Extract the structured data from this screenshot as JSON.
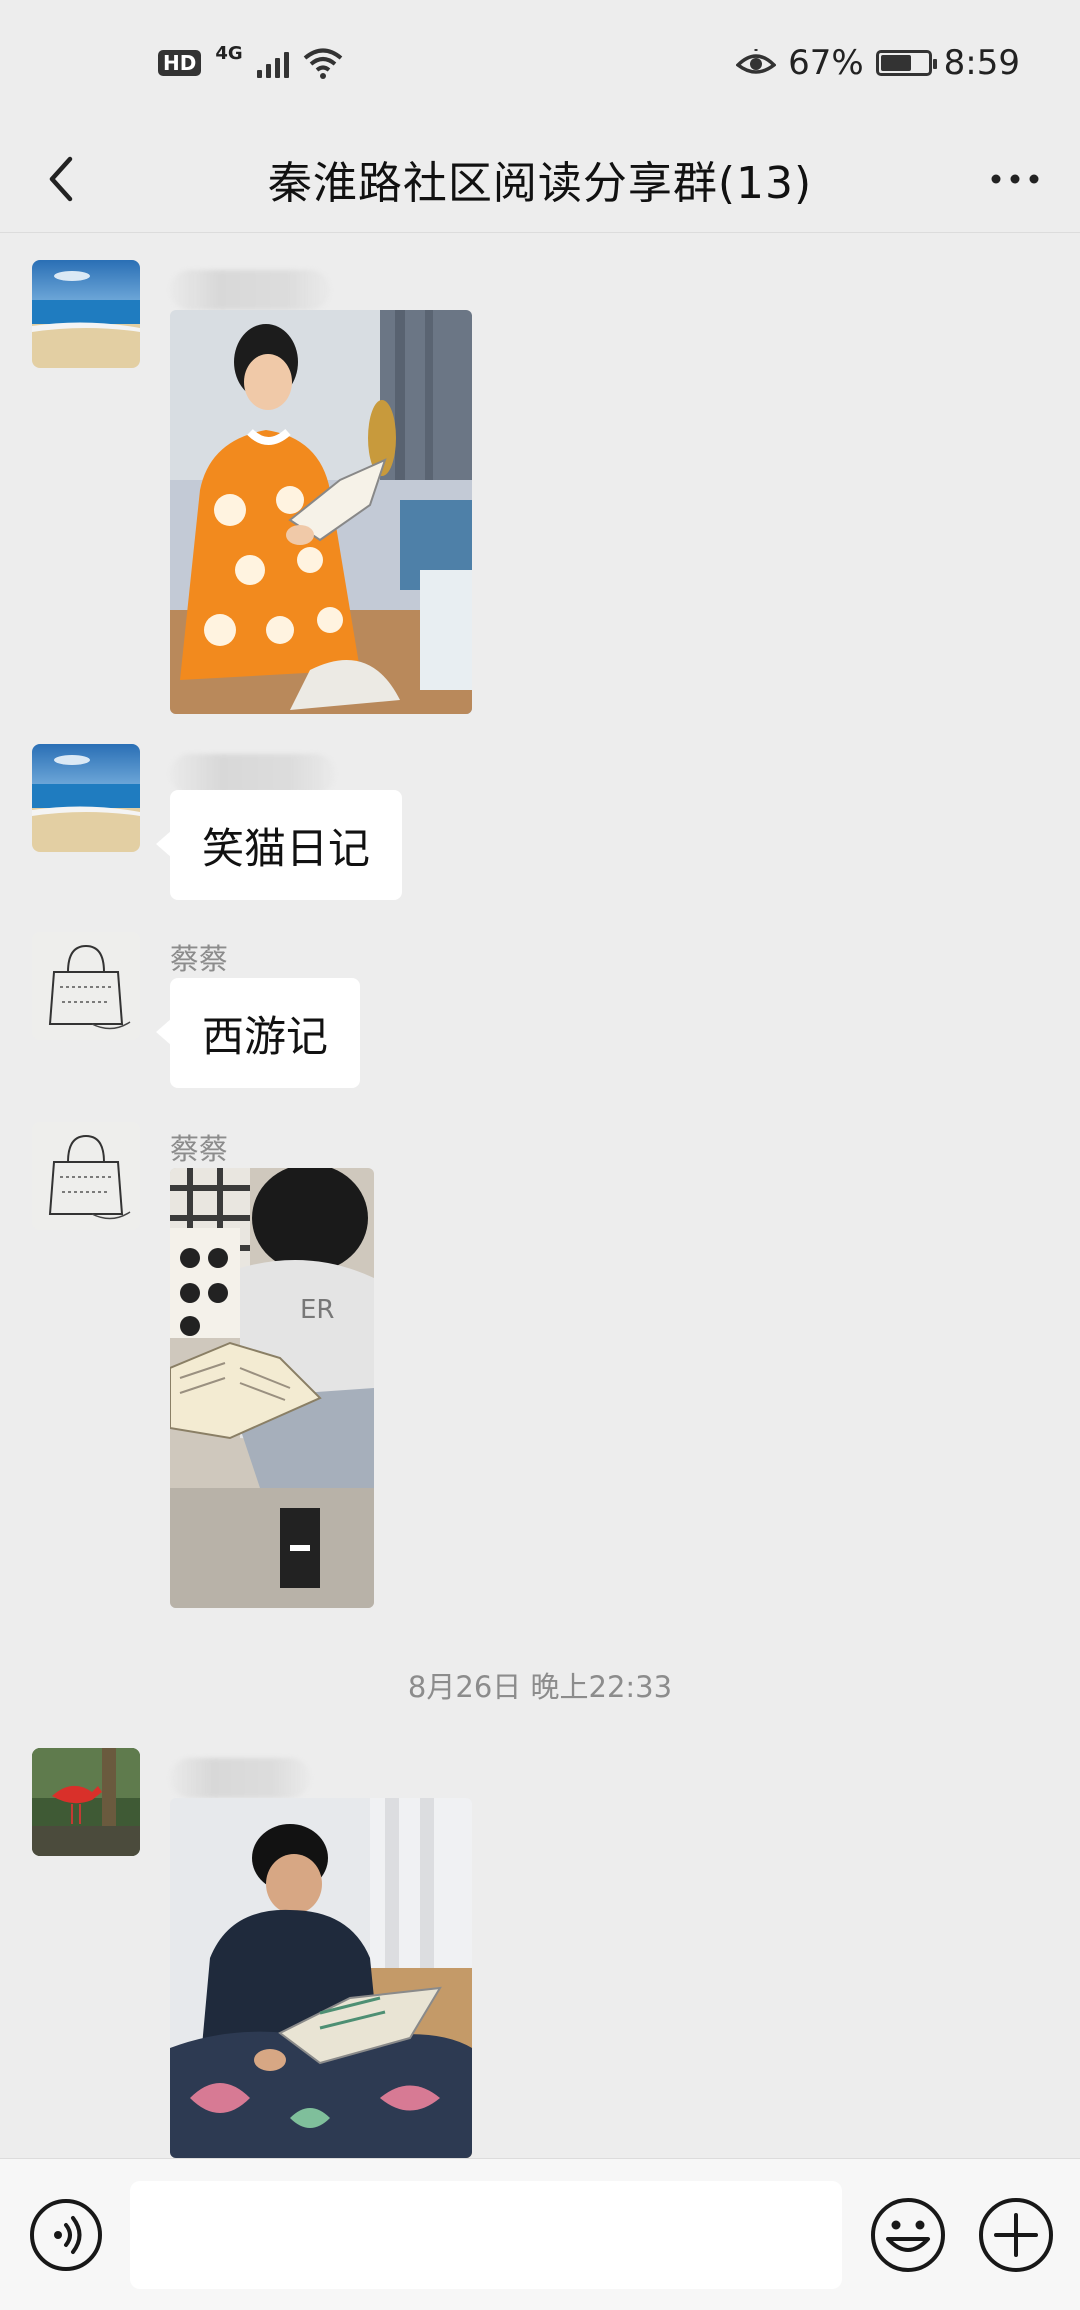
{
  "status_bar": {
    "hd": "HD",
    "network": "4G",
    "battery_percent": "67%",
    "battery_level": 0.67,
    "time": "8:59"
  },
  "header": {
    "title": "秦淮路社区阅读分享群(13)",
    "back_icon": "chevron-left-icon",
    "more_icon": "more-dots-icon"
  },
  "messages": [
    {
      "type": "image",
      "sender": "",
      "sender_blurred": true,
      "image": "girl reading book on bed"
    },
    {
      "type": "text",
      "sender": "",
      "sender_blurred": true,
      "text": "笑猫日记"
    },
    {
      "type": "text",
      "sender": "蔡蔡",
      "text": "西游记"
    },
    {
      "type": "image",
      "sender": "蔡蔡",
      "image": "child reading book on sofa"
    },
    {
      "type": "image",
      "sender": "",
      "sender_blurred": true,
      "image": "boy reading book in bed"
    }
  ],
  "timestamp": "8月26日 晚上22:33",
  "input_bar": {
    "value": "",
    "voice_icon": "voice-icon",
    "emoji_icon": "emoji-icon",
    "plus_icon": "plus-icon"
  },
  "colors": {
    "background": "#ededed",
    "bubble": "#ffffff",
    "meta_text": "#8c8c8c"
  }
}
